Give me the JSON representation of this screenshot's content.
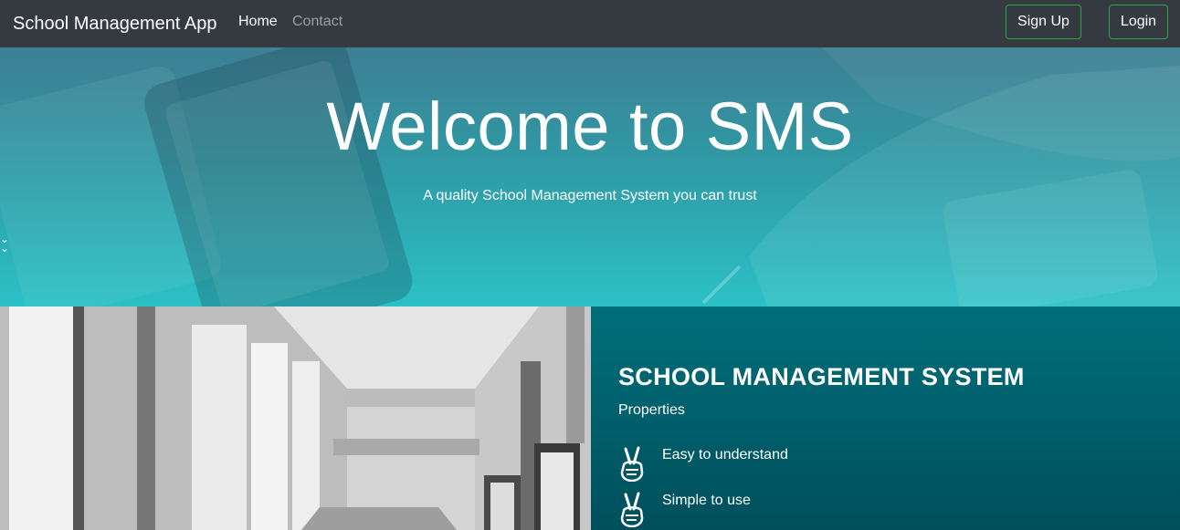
{
  "navbar": {
    "brand": "School Management App",
    "links": [
      {
        "label": "Home"
      },
      {
        "label": "Contact"
      }
    ],
    "signup_label": "Sign Up",
    "login_label": "Login"
  },
  "hero": {
    "title": "Welcome to SMS",
    "subtitle": "A quality School Management System you can trust",
    "scroll_icon": "double-chevron-down-icon"
  },
  "info": {
    "title": "SCHOOL MANAGEMENT SYSTEM",
    "subtitle": "Properties",
    "features": [
      {
        "icon": "victory-hand-icon",
        "label": "Easy to understand"
      },
      {
        "icon": "victory-hand-icon",
        "label": "Simple to use"
      }
    ]
  },
  "colors": {
    "navbar_bg": "#343a40",
    "button_border": "#28a745",
    "info_bg": "#006f7a"
  }
}
